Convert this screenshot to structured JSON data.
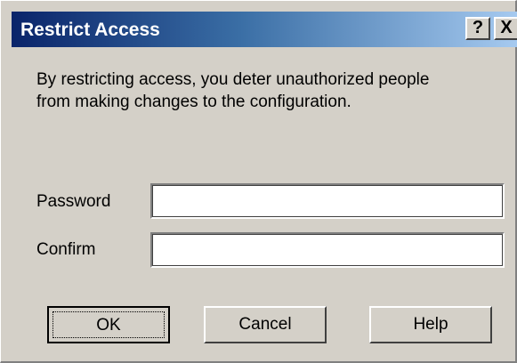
{
  "window": {
    "title": "Restrict Access",
    "help_glyph": "?",
    "close_glyph": "X"
  },
  "description": "By restricting access, you deter unauthorized people\nfrom making changes to the configuration.",
  "fields": {
    "password": {
      "label": "Password",
      "value": ""
    },
    "confirm": {
      "label": "Confirm",
      "value": ""
    }
  },
  "buttons": {
    "ok": "OK",
    "cancel": "Cancel",
    "help": "Help"
  },
  "colors": {
    "titlebar_start": "#0a246a",
    "titlebar_end": "#a6caf0",
    "dialog_face": "#d4d0c8"
  },
  "icons": {
    "help": "question-mark-icon",
    "close": "close-icon"
  }
}
